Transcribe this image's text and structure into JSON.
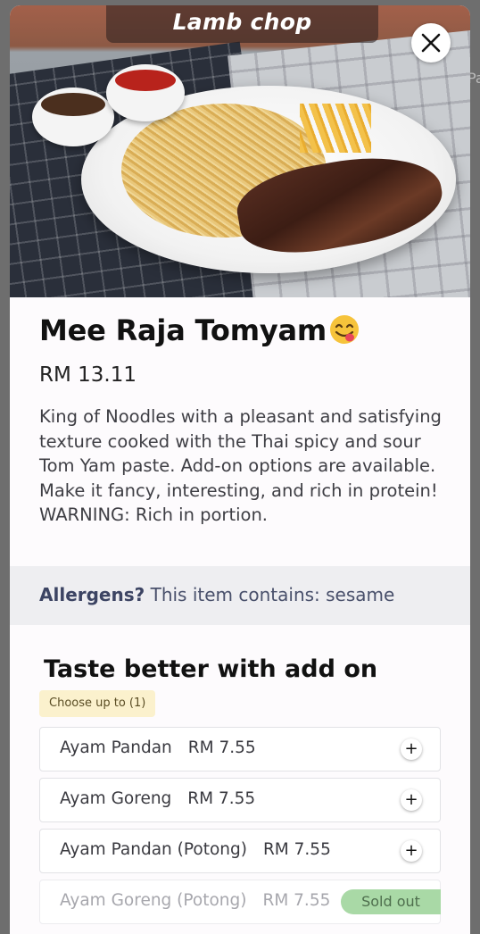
{
  "backdrop": {
    "peek_text": "Pa"
  },
  "hero": {
    "caption": "Lamb chop",
    "close_icon": "close-icon"
  },
  "item": {
    "title": "Mee Raja Tomyam",
    "title_emoji": "face-savoring-food-emoji",
    "price": "RM 13.11",
    "description": "King of Noodles with a pleasant and satisfying texture cooked with the Thai spicy and sour Tom Yam paste. Add-on options are available. Make it fancy, interesting, and rich in protein! WARNING: Rich in portion."
  },
  "allergens": {
    "label": "Allergens?",
    "text": "This item contains: sesame"
  },
  "addons": {
    "title": "Taste better with add on",
    "limit": "Choose up to (1)",
    "options": [
      {
        "name": "Ayam Pandan",
        "price": "RM 7.55",
        "status": "available"
      },
      {
        "name": "Ayam Goreng",
        "price": "RM 7.55",
        "status": "available"
      },
      {
        "name": "Ayam Pandan (Potong)",
        "price": "RM 7.55",
        "status": "available"
      },
      {
        "name": "Ayam Goreng (Potong)",
        "price": "RM 7.55",
        "status": "Sold out"
      }
    ]
  },
  "colors": {
    "allergen_bg": "#eeeef1",
    "limit_badge_bg": "#fbf1cd",
    "soldout_bg": "#a9d9a6"
  }
}
